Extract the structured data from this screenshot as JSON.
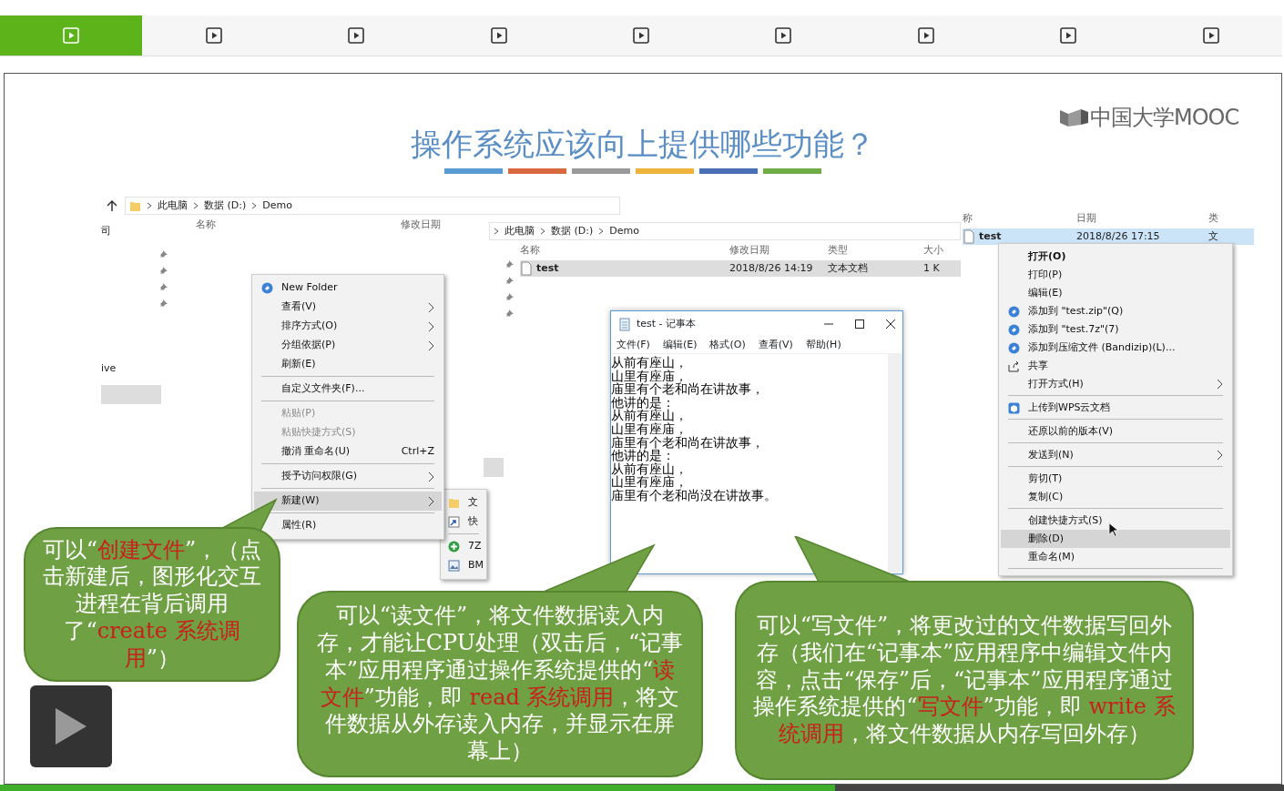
{
  "tabs": [
    {
      "selected": true
    },
    {
      "selected": false
    },
    {
      "selected": false
    },
    {
      "selected": false
    },
    {
      "selected": false
    },
    {
      "selected": false
    },
    {
      "selected": false
    },
    {
      "selected": false
    },
    {
      "selected": false
    }
  ],
  "slide": {
    "title": "操作系统应该向上提供哪些功能？",
    "logo": "中国大学MOOC",
    "explorers": [
      {
        "breadcrumb": [
          "此电脑",
          "数据 (D:)",
          "Demo"
        ],
        "nav_labels": [
          "司",
          "ive"
        ],
        "columns": [
          "名称",
          "修改日期"
        ]
      },
      {
        "breadcrumb": [
          "此电脑",
          "数据 (D:)",
          "Demo"
        ],
        "columns": [
          "名称",
          "修改日期",
          "类型",
          "大小"
        ],
        "rows": [
          {
            "cells": [
              "test",
              "2018/8/26 14:19",
              "文本文档",
              "1 K"
            ],
            "selected": true,
            "focused": false
          }
        ]
      },
      {
        "columns": [
          "称",
          "日期",
          "类"
        ],
        "rows": [
          {
            "cells": [
              "test",
              "2018/8/26 17:15",
              "文"
            ],
            "selected": true,
            "focused": true
          }
        ]
      }
    ],
    "folder_menu": [
      {
        "kind": "item",
        "label": "New Folder",
        "submenu": false,
        "disabled": false,
        "selected": false
      },
      {
        "kind": "item",
        "label": "查看(V)",
        "submenu": true,
        "disabled": false,
        "selected": false
      },
      {
        "kind": "item",
        "label": "排序方式(O)",
        "submenu": true,
        "disabled": false,
        "selected": false
      },
      {
        "kind": "item",
        "label": "分组依据(P)",
        "submenu": true,
        "disabled": false,
        "selected": false
      },
      {
        "kind": "item",
        "label": "刷新(E)",
        "submenu": false,
        "disabled": false,
        "selected": false
      },
      {
        "kind": "separator"
      },
      {
        "kind": "item",
        "label": "自定义文件夹(F)...",
        "submenu": false,
        "disabled": false,
        "selected": false
      },
      {
        "kind": "separator"
      },
      {
        "kind": "item",
        "label": "粘贴(P)",
        "submenu": false,
        "disabled": true,
        "selected": false
      },
      {
        "kind": "item",
        "label": "粘贴快捷方式(S)",
        "submenu": false,
        "disabled": true,
        "selected": false
      },
      {
        "kind": "item",
        "label": "撤消 重命名(U)",
        "shortcut": "Ctrl+Z",
        "submenu": false,
        "disabled": false,
        "selected": false
      },
      {
        "kind": "separator"
      },
      {
        "kind": "item",
        "label": "授予访问权限(G)",
        "submenu": true,
        "disabled": false,
        "selected": false
      },
      {
        "kind": "separator"
      },
      {
        "kind": "item",
        "label": "新建(W)",
        "submenu": true,
        "disabled": false,
        "selected": true
      },
      {
        "kind": "separator"
      },
      {
        "kind": "item",
        "label": "属性(R)",
        "submenu": false,
        "disabled": false,
        "selected": false
      }
    ],
    "new_submenu": [
      {
        "kind": "item",
        "label": "文"
      },
      {
        "kind": "item",
        "label": "快"
      },
      {
        "kind": "separator"
      },
      {
        "kind": "item",
        "label": "7Z"
      },
      {
        "kind": "item",
        "label": "BM"
      }
    ],
    "notepad": {
      "title": "test - 记事本",
      "menu": [
        "文件(F)",
        "编辑(E)",
        "格式(O)",
        "查看(V)",
        "帮助(H)"
      ],
      "lines": [
        "从前有座山，",
        "山里有座庙，",
        "庙里有个老和尚在讲故事，",
        "他讲的是：",
        "从前有座山，",
        "山里有座庙，",
        "庙里有个老和尚在讲故事，",
        "他讲的是：",
        "从前有座山，",
        "山里有座庙，",
        "庙里有个老和尚没在讲故事。"
      ]
    },
    "file_menu": [
      {
        "kind": "item",
        "label": "打开(O)",
        "bold": true,
        "submenu": false,
        "selected": false
      },
      {
        "kind": "item",
        "label": "打印(P)",
        "submenu": false,
        "selected": false
      },
      {
        "kind": "item",
        "label": "编辑(E)",
        "submenu": false,
        "selected": false
      },
      {
        "kind": "item",
        "label": "添加到 \"test.zip\"(Q)",
        "submenu": false,
        "selected": false
      },
      {
        "kind": "item",
        "label": "添加到 \"test.7z\"(7)",
        "submenu": false,
        "selected": false
      },
      {
        "kind": "item",
        "label": "添加到压缩文件 (Bandizip)(L)...",
        "submenu": false,
        "selected": false
      },
      {
        "kind": "item",
        "label": "共享",
        "submenu": false,
        "selected": false
      },
      {
        "kind": "item",
        "label": "打开方式(H)",
        "submenu": true,
        "selected": false
      },
      {
        "kind": "separator"
      },
      {
        "kind": "item",
        "label": "上传到WPS云文档",
        "submenu": false,
        "selected": false
      },
      {
        "kind": "separator"
      },
      {
        "kind": "item",
        "label": "还原以前的版本(V)",
        "submenu": false,
        "selected": false
      },
      {
        "kind": "separator"
      },
      {
        "kind": "item",
        "label": "发送到(N)",
        "submenu": true,
        "selected": false
      },
      {
        "kind": "separator"
      },
      {
        "kind": "item",
        "label": "剪切(T)",
        "submenu": false,
        "selected": false
      },
      {
        "kind": "item",
        "label": "复制(C)",
        "submenu": false,
        "selected": false
      },
      {
        "kind": "separator"
      },
      {
        "kind": "item",
        "label": "创建快捷方式(S)",
        "submenu": false,
        "selected": false
      },
      {
        "kind": "item",
        "label": "删除(D)",
        "submenu": false,
        "selected": true
      },
      {
        "kind": "item",
        "label": "重命名(M)",
        "submenu": false,
        "selected": false
      },
      {
        "kind": "separator"
      }
    ],
    "bubbles": [
      {
        "parts": [
          {
            "text": "可以“",
            "emphasis": false
          },
          {
            "text": "创建文件",
            "emphasis": true
          },
          {
            "text": "”，（点击新建后，图形化交互进程在背后调用了“",
            "emphasis": false
          },
          {
            "text": "create 系统调用",
            "emphasis": true
          },
          {
            "text": "”）",
            "emphasis": false
          }
        ]
      },
      {
        "parts": [
          {
            "text": "可以“读文件”，将文件数据读入内存，才能让CPU处理（双击后，“记事本”应用程序通过操作系统提供的“",
            "emphasis": false
          },
          {
            "text": "读文件",
            "emphasis": true
          },
          {
            "text": "”功能，即 ",
            "emphasis": false
          },
          {
            "text": "read 系统调用",
            "emphasis": true
          },
          {
            "text": "，将文件数据从外存读入内存，并显示在屏幕上）",
            "emphasis": false
          }
        ]
      },
      {
        "parts": [
          {
            "text": "可以“写文件”，将更改过的文件数据写回外存（我们在“记事本”应用程序中编辑文件内容，点击“保存”后，“记事本”应用程序通过操作系统提供的“",
            "emphasis": false
          },
          {
            "text": "写文件",
            "emphasis": true
          },
          {
            "text": "”功能，即 ",
            "emphasis": false
          },
          {
            "text": "write 系统调用",
            "emphasis": true
          },
          {
            "text": "，将文件数据从内存写回外存）",
            "emphasis": false
          }
        ]
      }
    ]
  },
  "progress": {
    "level": 0.65
  }
}
